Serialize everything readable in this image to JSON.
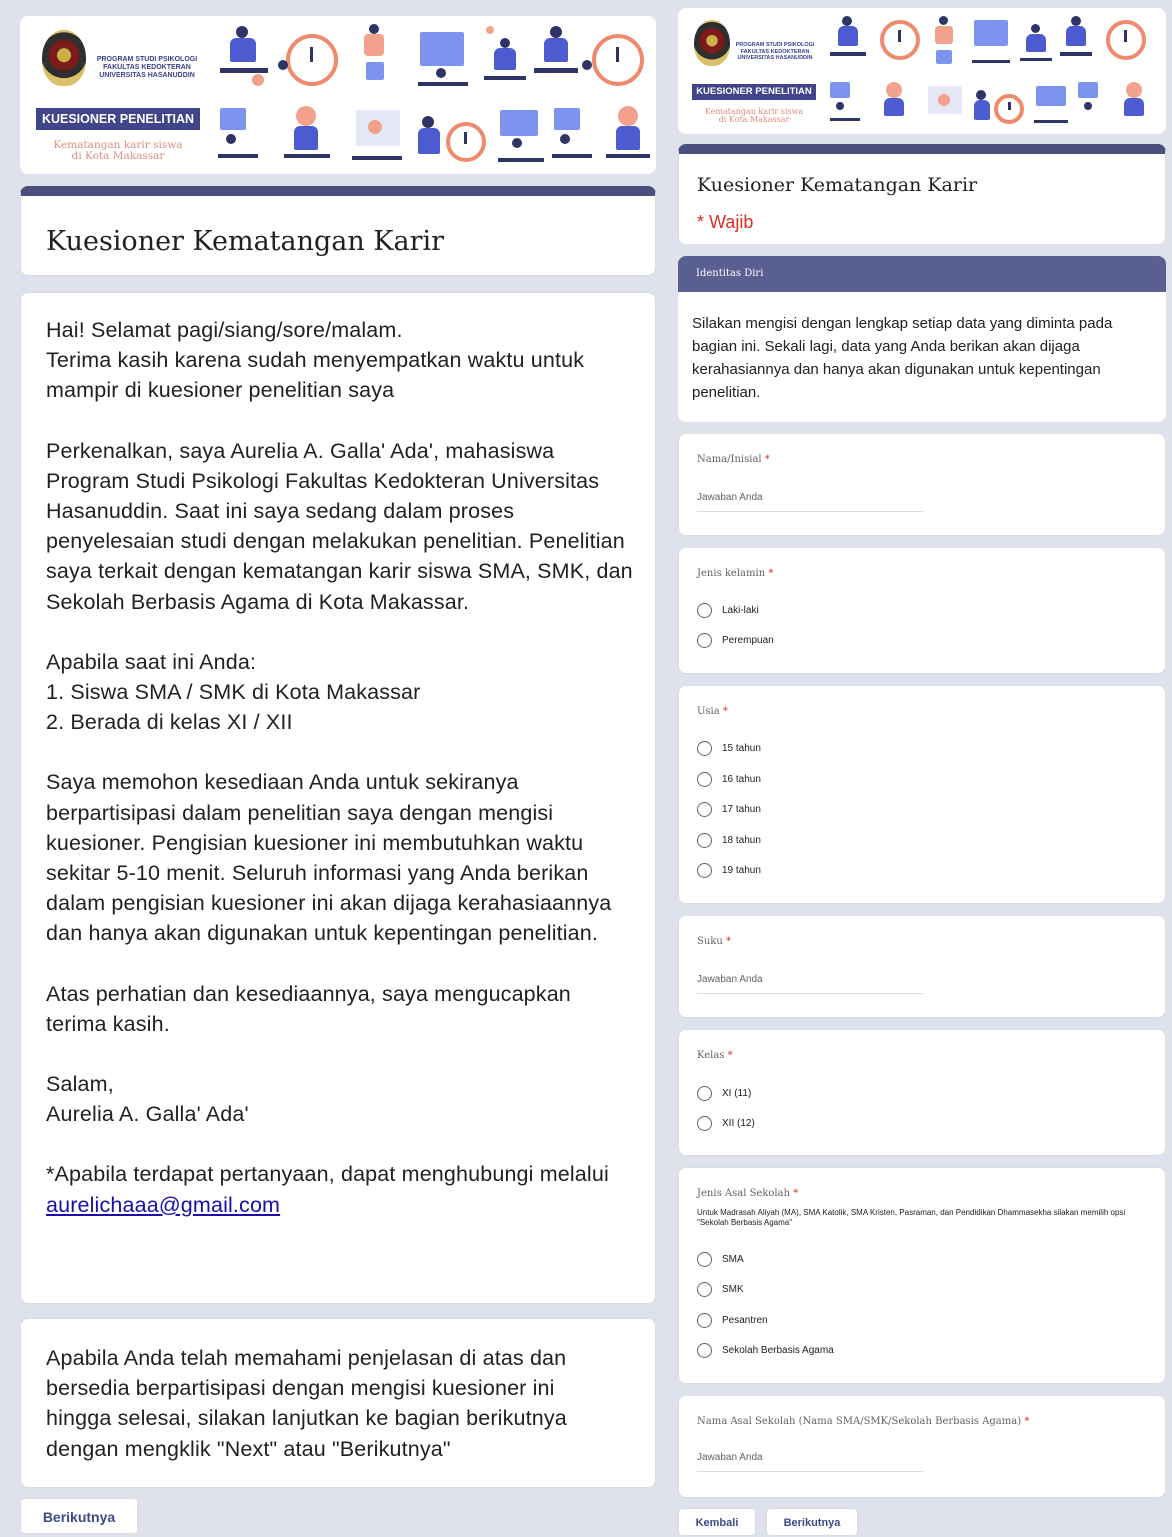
{
  "banner": {
    "program_line1": "PROGRAM STUDI PSIKOLOGI",
    "program_line2": "FAKULTAS KEDOKTERAN",
    "program_line3": "UNIVERSITAS HASANUDDIN",
    "tag": "KUESIONER PENELITIAN",
    "subtitle_line1": "Kematangan karir siswa",
    "subtitle_line2": "di Kota Makassar"
  },
  "left_page": {
    "form_title": "Kuesioner Kematangan Karir",
    "intro": {
      "p1_l1": "Hai! Selamat pagi/siang/sore/malam.",
      "p1_l2": "Terima kasih karena sudah menyempatkan waktu untuk mampir di kuesioner penelitian saya",
      "p2": "Perkenalkan, saya Aurelia A. Galla' Ada', mahasiswa Program Studi Psikologi Fakultas Kedokteran Universitas Hasanuddin. Saat ini saya sedang dalam proses penyelesaian studi dengan melakukan penelitian. Penelitian saya terkait dengan kematangan karir siswa SMA, SMK, dan Sekolah Berbasis Agama di Kota Makassar.",
      "p3_l1": "Apabila saat ini Anda:",
      "p3_l2": "1. Siswa SMA / SMK di Kota Makassar",
      "p3_l3": "2. Berada di kelas XI / XII",
      "p4": "Saya memohon kesediaan Anda untuk sekiranya berpartisipasi dalam penelitian saya dengan mengisi kuesioner. Pengisian kuesioner ini membutuhkan waktu sekitar 5-10 menit. Seluruh informasi yang Anda berikan dalam pengisian kuesioner ini akan dijaga kerahasiaannya dan hanya akan digunakan untuk kepentingan penelitian.",
      "p5": "Atas perhatian dan kesediaannya, saya mengucapkan terima kasih.",
      "p6_l1": "Salam,",
      "p6_l2": "Aurelia A. Galla' Ada'",
      "p7_text": "*Apabila terdapat pertanyaan, dapat menghubungi melalui",
      "p7_email": "aurelichaaa@gmail.com"
    },
    "next_note": "Apabila Anda telah memahami penjelasan di atas dan bersedia berpartisipasi dengan mengisi kuesioner ini hingga selesai, silakan lanjutkan ke bagian berikutnya dengan mengklik \"Next\" atau \"Berikutnya\"",
    "next_button": "Berikutnya"
  },
  "right_page": {
    "form_title": "Kuesioner Kematangan Karir",
    "required_note": "* Wajib",
    "section_title": "Identitas Diri",
    "section_desc": "Silakan mengisi dengan lengkap setiap data yang diminta pada bagian ini. Sekali lagi, data yang Anda berikan akan dijaga kerahasiannya dan hanya akan digunakan untuk kepentingan penelitian.",
    "answer_placeholder": "Jawaban Anda",
    "required_star": "*",
    "q_nama": "Nama/Inisial",
    "q_jenis_kelamin": "Jenis kelamin",
    "jenis_kelamin_options": [
      "Laki-laki",
      "Perempuan"
    ],
    "q_usia": "Usia",
    "usia_options": [
      "15 tahun",
      "16 tahun",
      "17 tahun",
      "18 tahun",
      "19 tahun"
    ],
    "q_suku": "Suku",
    "q_kelas": "Kelas",
    "kelas_options": [
      "XI (11)",
      "XII (12)"
    ],
    "q_jenis_sekolah": "Jenis Asal Sekolah",
    "q_jenis_sekolah_help": "Untuk Madrasah Aliyah (MA), SMA Katolik, SMA Kristen, Pasraman, dan Pendidikan Dhammasekha silakan memilih opsi \"Sekolah Berbasis Agama\"",
    "jenis_sekolah_options": [
      "SMA",
      "SMK",
      "Pesantren",
      "Sekolah Berbasis Agama"
    ],
    "q_nama_sekolah": "Nama Asal Sekolah (Nama SMA/SMK/Sekolah Berbasis Agama)",
    "back_button": "Kembali",
    "next_button": "Berikutnya"
  },
  "colors": {
    "background": "#dfe1ec",
    "header_accent": "#4a4f7d",
    "section_header": "#5a5f92",
    "required": "#d93025",
    "link": "#1a0dab",
    "button_text": "#3f4a8a"
  }
}
